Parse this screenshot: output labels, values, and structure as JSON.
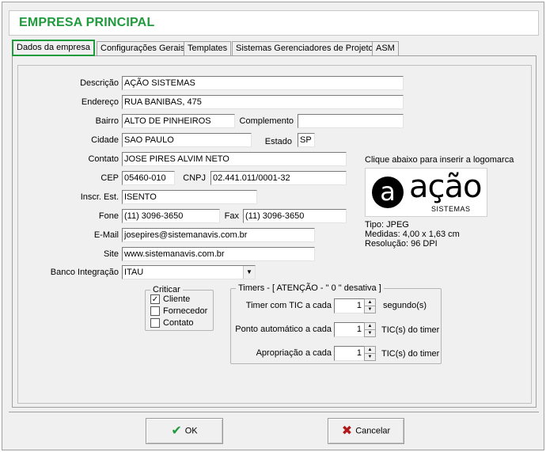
{
  "window": {
    "title": "EMPRESA PRINCIPAL"
  },
  "tabs": [
    {
      "label": "Dados da empresa",
      "active": true
    },
    {
      "label": "Configurações Gerais",
      "active": false
    },
    {
      "label": "Templates",
      "active": false
    },
    {
      "label": "Sistemas Gerenciadores de Projeto",
      "active": false
    },
    {
      "label": "ASM",
      "active": false
    }
  ],
  "form": {
    "descricao": {
      "label": "Descrição",
      "value": "AÇÃO SISTEMAS"
    },
    "endereco": {
      "label": "Endereço",
      "value": "RUA BANIBAS, 475"
    },
    "bairro": {
      "label": "Bairro",
      "value": "ALTO DE PINHEIROS"
    },
    "complemento": {
      "label": "Complemento",
      "value": ""
    },
    "cidade": {
      "label": "Cidade",
      "value": "SAO PAULO"
    },
    "estado": {
      "label": "Estado",
      "value": "SP"
    },
    "contato": {
      "label": "Contato",
      "value": "JOSE PIRES ALVIM NETO"
    },
    "cep": {
      "label": "CEP",
      "value": "05460-010"
    },
    "cnpj": {
      "label": "CNPJ",
      "value": "02.441.011/0001-32"
    },
    "inscr_est": {
      "label": "Inscr. Est.",
      "value": "ISENTO"
    },
    "fone": {
      "label": "Fone",
      "value": "(11) 3096-3650"
    },
    "fax": {
      "label": "Fax",
      "value": "(11) 3096-3650"
    },
    "email": {
      "label": "E-Mail",
      "value": "josepires@sistemanavis.com.br"
    },
    "site": {
      "label": "Site",
      "value": "www.sistemanavis.com.br"
    },
    "banco": {
      "label": "Banco Integração",
      "value": "ITAU"
    }
  },
  "criticar": {
    "title": "Criticar",
    "items": [
      {
        "label": "Cliente",
        "checked": true
      },
      {
        "label": "Fornecedor",
        "checked": false
      },
      {
        "label": "Contato",
        "checked": false
      }
    ]
  },
  "timers": {
    "title": "Timers - [ ATENÇÃO - \" 0 \" desativa ]",
    "rows": [
      {
        "label": "Timer com TIC a cada",
        "value": "1",
        "unit": "segundo(s)"
      },
      {
        "label": "Ponto automático a cada",
        "value": "1",
        "unit": "TIC(s) do timer"
      },
      {
        "label": "Apropriação a cada",
        "value": "1",
        "unit": "TIC(s) do timer"
      }
    ]
  },
  "logo": {
    "hint": "Clique abaixo para inserir a logomarca",
    "mark": "a",
    "word": "ação",
    "sub": "SISTEMAS",
    "tipo": "Tipo: JPEG",
    "medidas": "Medidas: 4,00 x 1,63 cm",
    "resolucao": "Resolução: 96 DPI"
  },
  "buttons": {
    "ok": "OK",
    "cancel": "Cancelar"
  },
  "icons": {
    "ok": "check-icon",
    "cancel": "x-icon",
    "dropdown": "chevron-down-icon"
  },
  "colors": {
    "title": "#1f9a3c",
    "ok": "#1f9a3c",
    "cancel": "#b11a1a"
  }
}
